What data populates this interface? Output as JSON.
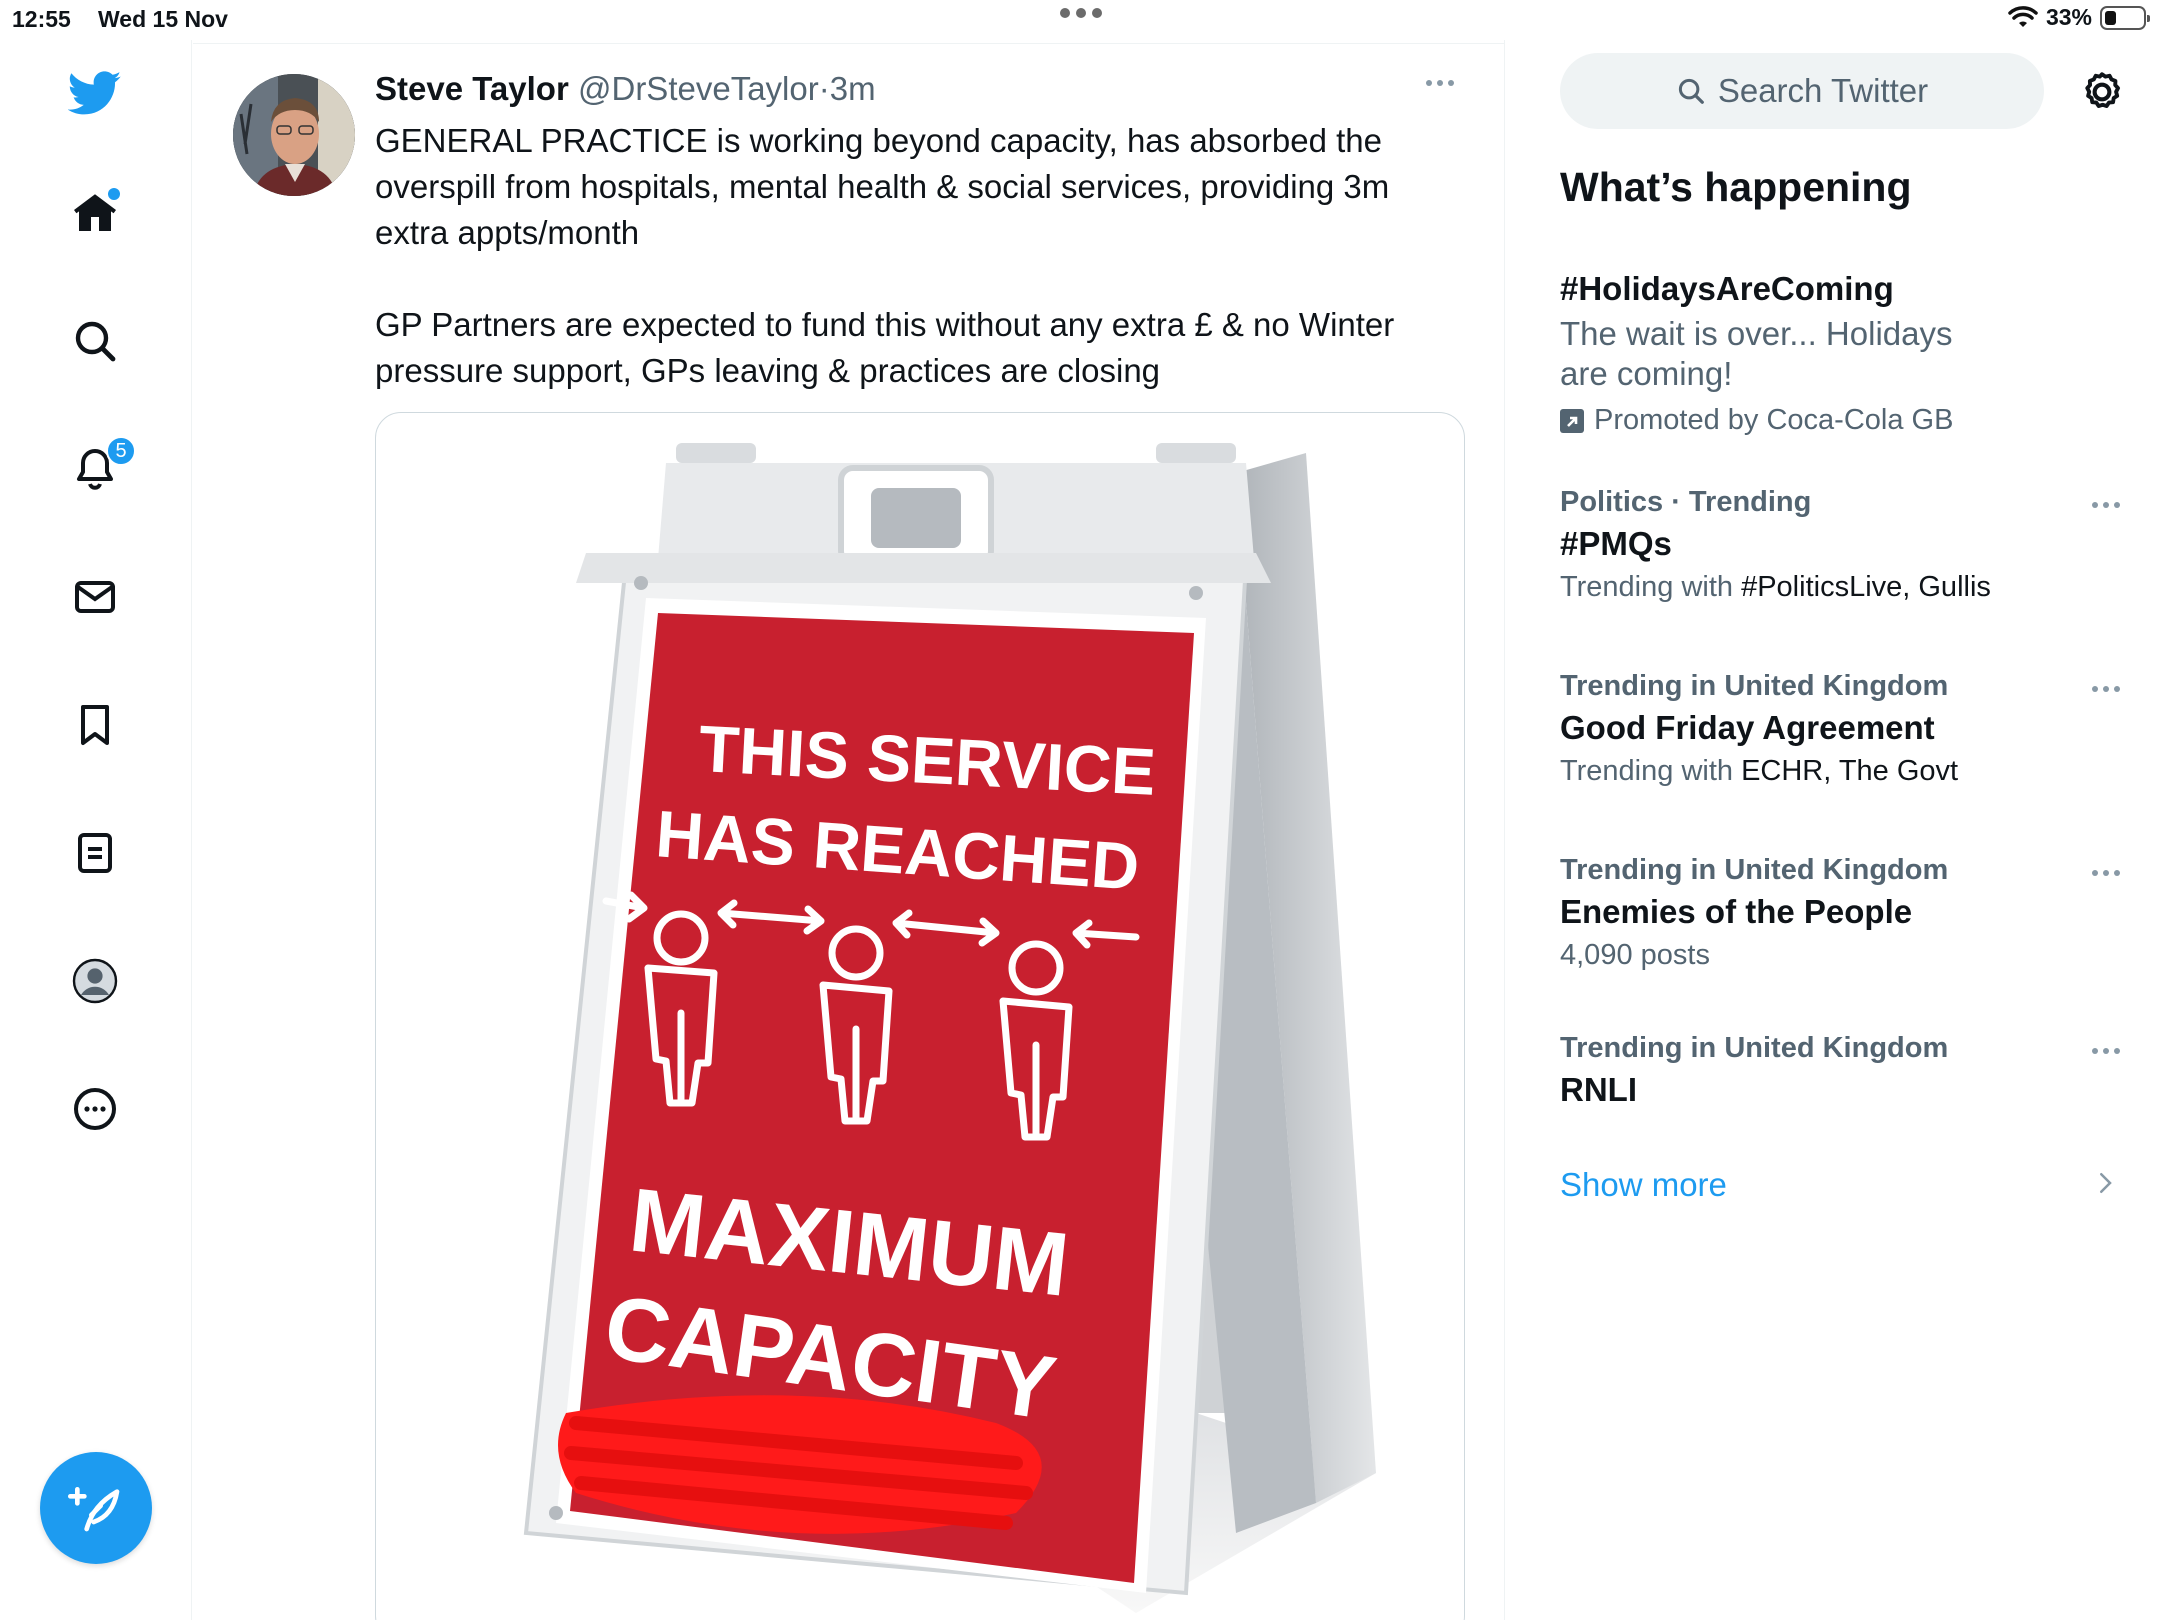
{
  "status_bar": {
    "time": "12:55",
    "date": "Wed 15 Nov",
    "battery": "33%"
  },
  "nav": {
    "notifications_badge": "5",
    "icons": [
      "twitter-logo-icon",
      "home-icon",
      "search-icon",
      "bell-icon",
      "mail-icon",
      "bookmark-icon",
      "lists-icon",
      "profile-icon",
      "more-icon",
      "compose-icon"
    ]
  },
  "tweet": {
    "name": "Steve Taylor",
    "handle": "@DrSteveTaylor",
    "separator": "·",
    "time": "3m",
    "paragraphs": [
      "GENERAL PRACTICE is working beyond capacity, has absorbed the overspill from hospitals, mental health & social services, providing 3m extra appts/month",
      "GP Partners are expected to fund this without any extra £ & no Winter pressure support, GPs leaving & practices are closing"
    ],
    "image": {
      "line1": "THIS SERVICE",
      "line2": "HAS REACHED",
      "line3": "MAXIMUM",
      "line4": "CAPACITY"
    }
  },
  "sidebar": {
    "search_placeholder": "Search Twitter",
    "whats_happening": "What’s happening",
    "trends": [
      {
        "topic": "#HolidaysAreComing",
        "description": "The wait is over... Holidays are coming!",
        "promoted": "Promoted by Coca-Cola GB"
      },
      {
        "meta": "Politics · Trending",
        "topic": "#PMQs",
        "sub_label": "Trending with",
        "sub_value": "#PoliticsLive, Gullis"
      },
      {
        "meta": "Trending in United Kingdom",
        "topic": "Good Friday Agreement",
        "sub_label": "Trending with",
        "sub_value": "ECHR, The Govt"
      },
      {
        "meta": "Trending in United Kingdom",
        "topic": "Enemies of the People",
        "posts": "4,090 posts"
      },
      {
        "meta": "Trending in United Kingdom",
        "topic": "RNLI"
      }
    ],
    "show_more": "Show more"
  },
  "colors": {
    "accent": "#1d9bf0",
    "sign_red": "#c8202f",
    "scribble_red": "#ff1a1a",
    "text_primary": "#0f1419",
    "text_secondary": "#536471"
  }
}
